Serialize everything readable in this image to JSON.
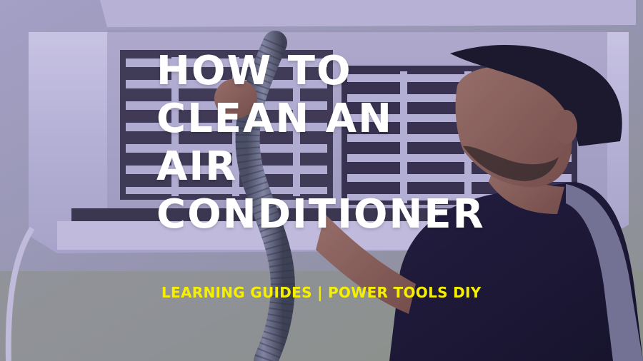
{
  "image": {
    "subject": "Person cleaning an air conditioner with a vacuum hose",
    "tint_color": "#624eb2"
  },
  "title": {
    "lines": [
      "HOW TO",
      "CLEAN AN",
      "AIR",
      "CONDITIONER"
    ]
  },
  "subtitle": "LEARNING GUIDES | POWER TOOLS DIY",
  "colors": {
    "title": "#ffffff",
    "subtitle": "#f6f000"
  }
}
